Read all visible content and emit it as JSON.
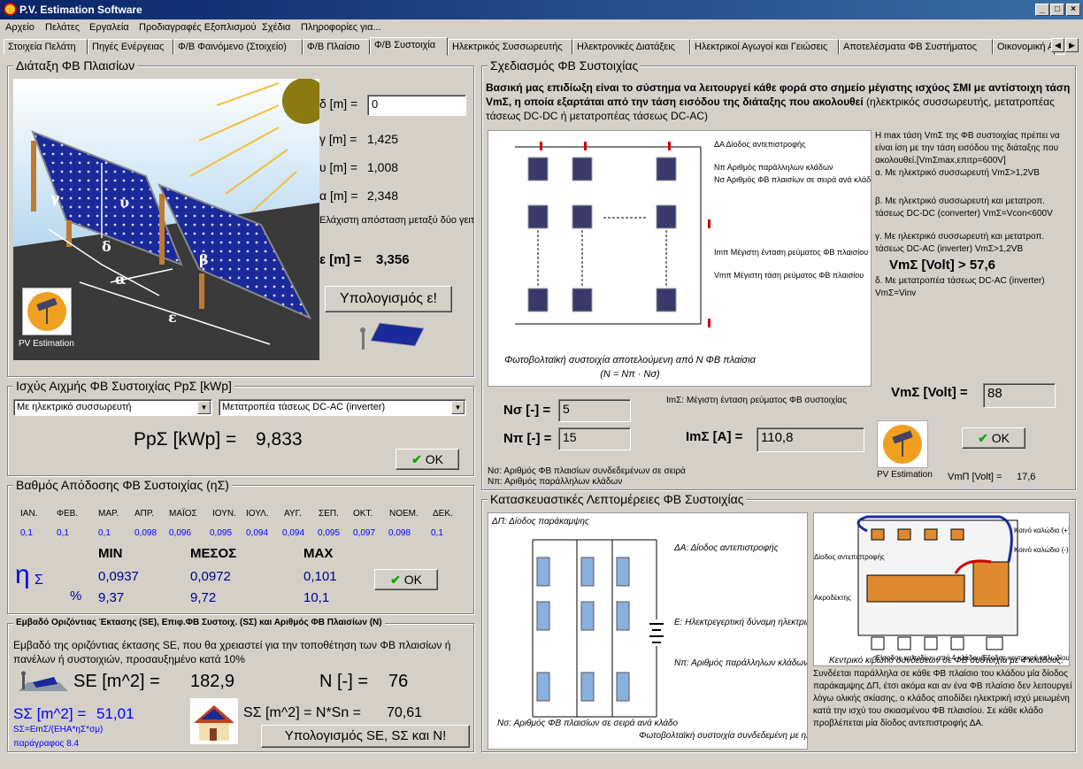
{
  "window": {
    "title": "P.V. Estimation Software"
  },
  "menu": [
    "Αρχείο",
    "Πελάτες",
    "Εργαλεία",
    "Προδιαγραφές Εξοπλισμού",
    "Σχέδια",
    "Πληροφορίες για..."
  ],
  "tabs": [
    "Στοιχεία Πελάτη",
    "Πηγές Ενέργειας",
    "Φ/Β Φαινόμενο (Στοιχείο)",
    "Φ/Β Πλαίσιο",
    "Φ/Β Συστοιχία",
    "Ηλεκτρικός Συσσωρευτής",
    "Ηλεκτρονικές Διατάξεις",
    "Ηλεκτρικοί Αγωγοί και Γειώσεις",
    "Αποτελέσματα ΦΒ Συστήματος",
    "Οικονομική Α"
  ],
  "layout": {
    "title": "Διάταξη ΦΒ Πλαισίων",
    "delta_label": "δ [m] =",
    "delta_value": "0",
    "gamma_label": "γ [m] =",
    "gamma_value": "1,425",
    "u_label": "υ [m] =",
    "u_value": "1,008",
    "a_label": "α [m] =",
    "a_value": "2,348",
    "note": "Ελάχιστη απόσταση μεταξύ δύο γειτονικών σειρών ΦΒ πλαισίων ε",
    "e_label": "ε [m] =",
    "e_value": "3,356",
    "calc_button": "Υπολογισμός ε!",
    "logo_caption": "PV Estimation",
    "diagram_labels": {
      "g": "γ",
      "u": "υ",
      "d": "δ",
      "a": "α",
      "b": "β",
      "e": "ε"
    }
  },
  "peak": {
    "title": "Ισχύς Αιχμής ΦΒ Συστοιχίας PpΣ [kWp]",
    "combo1": "Με ηλεκτρικό συσσωρευτή",
    "combo2": "Μετατροπέα τάσεως DC-AC (inverter)",
    "result_label": "PpΣ [kWp] =",
    "result_value": "9,833",
    "ok": "OK"
  },
  "efficiency": {
    "title": "Βαθμός Απόδοσης ΦΒ Συστοιχίας (ηΣ)",
    "months": [
      "ΙΑΝ.",
      "ΦΕΒ.",
      "ΜΑΡ.",
      "ΑΠΡ.",
      "ΜΑΪΟΣ",
      "ΙΟΥΝ.",
      "ΙΟΥΛ.",
      "ΑΥΓ.",
      "ΣΕΠ.",
      "ΟΚΤ.",
      "ΝΟΕΜ.",
      "ΔΕΚ."
    ],
    "values": [
      "0,1",
      "0,1",
      "0,1",
      "0,098",
      "0,096",
      "0,095",
      "0,094",
      "0,094",
      "0,095",
      "0,097",
      "0,098",
      "0,1"
    ],
    "min_label": "MIN",
    "mean_label": "ΜΕΣΟΣ",
    "max_label": "MAX",
    "min": "0,0937",
    "mean": "0,0972",
    "max": "0,101",
    "min_pct": "9,37",
    "mean_pct": "9,72",
    "max_pct": "10,1",
    "eta": "η",
    "eta_sub": "Σ",
    "pct": "%",
    "ok": "OK"
  },
  "area": {
    "title": "Εμβαδό Οριζόντιας Έκτασης (SE), Επιφ.ΦΒ Συστοιχ. (SΣ) και Αριθμός ΦΒ Πλαισίων (N)",
    "desc": "Εμβαδό της οριζόντιας έκτασης SE, που θα χρειαστεί για την τοποθέτηση των ΦΒ πλαισίων ή πανέλων ή συστοιχιών, προσαυξημένο κατά 10%",
    "se_label": "SE [m^2] =",
    "se_value": "182,9",
    "n_label": "N [-] =",
    "n_value": "76",
    "ss_label": "SΣ [m^2] =",
    "ss_value": "51,01",
    "ss2_label": "SΣ [m^2] = N*Sn =",
    "ss2_value": "70,61",
    "formula": "SΣ=EmΣ/(ΕΗΑ*ηΣ*σμ)",
    "ref": "παράγραφος 8.4",
    "button": "Υπολογισμός SE, SΣ και N!"
  },
  "design": {
    "title": "Σχεδιασμός ΦΒ Συστοιχίας",
    "intro_bold": "Βασική μας επιδίωξη είναι το σύστημα να λειτουργεί κάθε φορά στο σημείο μέγιστης ισχύος ΣΜΙ με αντίστοιχη τάση VmΣ, η οποία εξαρτάται από την τάση εισόδου της διάταξης που ακολουθεί",
    "intro_rest": "(ηλεκτρικός συσσωρευτής, μετατροπέας τάσεως DC-DC ή μετατροπέας τάσεως DC-AC)",
    "side_text": "Η max τάση VmΣ της ΦΒ συστοιχίας πρέπει να είναι ίση με την τάση εισόδου της διάταξης που ακολουθεί.[VmΣmax,επιτρ=600V]",
    "case_a": "α. Με ηλεκτρικό συσσωρευτή VmΣ>1,2VB",
    "case_b": "β. Με ηλεκτρικό συσσωρευτή και μετατροπ. τάσεως DC-DC (converter) VmΣ=Vcon<600V",
    "case_c": "γ. Με ηλεκτρικό συσσωρευτή και μετατροπ. τάσεως DC-AC (inverter) VmΣ>1,2VB",
    "vm_gt": "VmΣ [Volt] > 57,6",
    "case_d": "δ. Με μετατροπέα τάσεως DC-AC (inverter) VmΣ=Vinv",
    "diagram_caption": "Φωτοβολταϊκή συστοιχία αποτελούμενη από Ν ΦΒ πλαίσια",
    "diagram_caption2": "(N = Nπ · Nσ)",
    "legend": [
      "ΔΑ  Δίοδος αντεπιστροφής",
      "Nπ  Αριθμός παράλληλων κλάδων",
      "Nσ  Αριθμός ΦΒ πλαισίων σε σειρά ανά κλάδο",
      "Imπ  Μέγιστη ένταση ρεύματος ΦΒ πλαισίου",
      "Vmπ  Μέγιστη τάση ρεύματος ΦΒ πλαισίου"
    ],
    "im_note": "ImΣ: Μέγιστη ένταση ρεύματος ΦΒ συστοιχίας",
    "ns_label": "Nσ [-] =",
    "ns_value": "5",
    "np_label": "Nπ [-] =",
    "np_value": "15",
    "im_label": "ImΣ [A] =",
    "im_value": "110,8",
    "vm_label": "VmΣ [Volt] =",
    "vm_value": "88",
    "ok": "OK",
    "foot1": "Nσ: Αριθμός ΦΒ πλαισίων συνδεδεμένων σε σειρά",
    "foot2": "Nπ: Αριθμός παράλληλων κλάδων",
    "logo_caption": "PV Estimation",
    "vmp_label": "VmΠ [Volt] =",
    "vmp_value": "17,6"
  },
  "construction": {
    "title": "Κατασκευαστικές Λεπτομέρειες ΦΒ Συστοιχίας",
    "dp": "ΔΠ: Δίοδος παράκαμψης",
    "da": "ΔΑ:  Δίοδος αντεπιστροφής",
    "e_desc": "E:   Ηλεκτρεγερτική δύναμη ηλεκτρικού συσσωρευτή",
    "np_desc": "Nπ:  Αριθμός παράλληλων κλάδων",
    "ns_desc": "Nσ:  Αριθμός ΦΒ πλαισίων σε σειρά ανά κλάδο",
    "caption1": "Φωτοβολταϊκή συστοιχία συνδεδεμένη με ηλεκτρικό συσσωρευτή.",
    "box_caption": "Κεντρικό κιβώτιο συνδέσεων σε ΦΒ συστοιχία με 4 κλάδους.",
    "box_labels": [
      "Κοινό καλώδιο (+)",
      "Κοινό καλώδιο (-)",
      "Δίοδος αντεπιστροφής",
      "Ακροδέκτης",
      "Είσοδος καλωδίων από 4 κλάδους",
      "Έξοδος κεντρικού καλωδίου"
    ],
    "desc": "Συνδέεται παράλληλα σε κάθε ΦΒ πλαίσιο του κλάδου μία δίοδος παράκαμψης ΔΠ, έτσι ακόμα και αν ένα ΦΒ πλαίσιο δεν λειτουργεί λόγω ολικής σκίασης, ο κλάδος αποδίδει ηλεκτρική ισχύ μειωμένη κατά την ισχύ του σκιασμένου ΦΒ πλαισίου. Σε κάθε κλάδο προβλέπεται μία δίοδος αντεπιστροφής ΔΑ."
  }
}
